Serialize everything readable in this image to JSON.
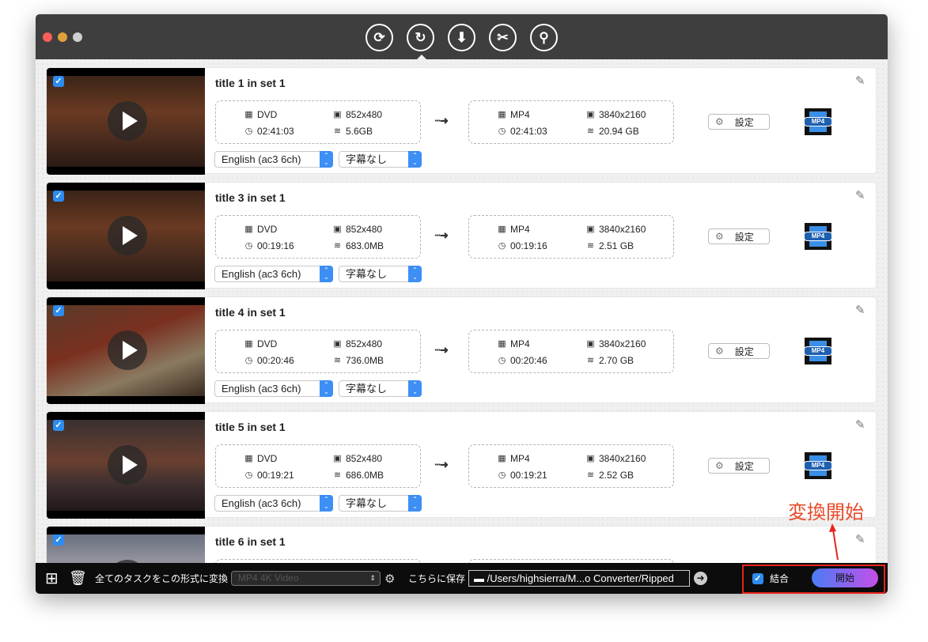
{
  "toolbar": {
    "nav": [
      {
        "name": "convert-icon",
        "glyph": "⟳"
      },
      {
        "name": "dvd-convert-icon",
        "glyph": "↻"
      },
      {
        "name": "video-download-icon",
        "glyph": "⬇"
      },
      {
        "name": "video-edit-icon",
        "glyph": "✂"
      },
      {
        "name": "video-tools-icon",
        "glyph": "⚲"
      }
    ]
  },
  "titles": [
    {
      "title": "title 1 in set 1",
      "src": {
        "format": "DVD",
        "resolution": "852x480",
        "duration": "02:41:03",
        "size": "5.6GB"
      },
      "dst": {
        "format": "MP4",
        "resolution": "3840x2160",
        "duration": "02:41:03",
        "size": "20.94 GB"
      },
      "audio": "English (ac3 6ch)",
      "subtitle": "字幕なし",
      "settings": "設定",
      "checked": true
    },
    {
      "title": "title 3 in set 1",
      "src": {
        "format": "DVD",
        "resolution": "852x480",
        "duration": "00:19:16",
        "size": "683.0MB"
      },
      "dst": {
        "format": "MP4",
        "resolution": "3840x2160",
        "duration": "00:19:16",
        "size": "2.51 GB"
      },
      "audio": "English (ac3 6ch)",
      "subtitle": "字幕なし",
      "settings": "設定",
      "checked": true
    },
    {
      "title": "title 4 in set 1",
      "src": {
        "format": "DVD",
        "resolution": "852x480",
        "duration": "00:20:46",
        "size": "736.0MB"
      },
      "dst": {
        "format": "MP4",
        "resolution": "3840x2160",
        "duration": "00:20:46",
        "size": "2.70 GB"
      },
      "audio": "English (ac3 6ch)",
      "subtitle": "字幕なし",
      "settings": "設定",
      "checked": true
    },
    {
      "title": "title 5 in set 1",
      "src": {
        "format": "DVD",
        "resolution": "852x480",
        "duration": "00:19:21",
        "size": "686.0MB"
      },
      "dst": {
        "format": "MP4",
        "resolution": "3840x2160",
        "duration": "00:19:21",
        "size": "2.52 GB"
      },
      "audio": "English (ac3 6ch)",
      "subtitle": "字幕なし",
      "settings": "設定",
      "checked": true
    },
    {
      "title": "title 6 in set 1",
      "checked": true
    }
  ],
  "format_badge": "MP4",
  "bottom": {
    "convert_all_label": "全てのタスクをこの形式に変換",
    "format_value": "MP4 4K Video",
    "save_label": "こちらに保存",
    "save_path": "/Users/highsierra/M...o Converter/Ripped",
    "merge_label": "結合",
    "merge_checked": true,
    "start_label": "開始"
  },
  "annotation": "変換開始",
  "colors": {
    "accent": "#2d8cf0",
    "annotation": "#e8231b",
    "titlebar": "#3e3e3e"
  }
}
